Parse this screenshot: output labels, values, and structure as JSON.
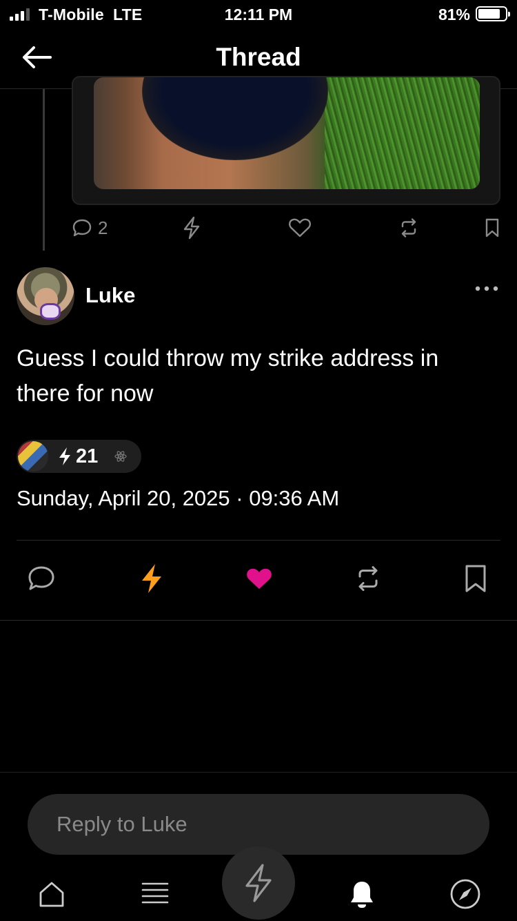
{
  "status_bar": {
    "carrier": "T-Mobile  LTE",
    "time": "12:11 PM",
    "battery_percent": "81%",
    "battery_level": 0.81
  },
  "header": {
    "title": "Thread",
    "back_icon": "arrow-left-icon"
  },
  "parent_post": {
    "reply_count": "2",
    "action_icons": [
      "reply-icon",
      "zap-icon",
      "heart-icon",
      "repost-icon",
      "bookmark-icon"
    ]
  },
  "post": {
    "author": "Luke",
    "text": "Guess I could throw my strike address in there for now",
    "zap_amount": "21",
    "timestamp": "Sunday, April 20, 2025 · 09:36 AM",
    "liked": true,
    "zapped": true
  },
  "reply": {
    "placeholder": "Reply to Luke"
  },
  "tab_bar": {
    "items": [
      "home-icon",
      "feed-icon",
      "zap-icon",
      "notifications-icon",
      "explore-icon"
    ]
  },
  "colors": {
    "zap_orange": "#FF9F1C",
    "like_pink": "#E0118A",
    "muted": "#8A8A8A"
  }
}
